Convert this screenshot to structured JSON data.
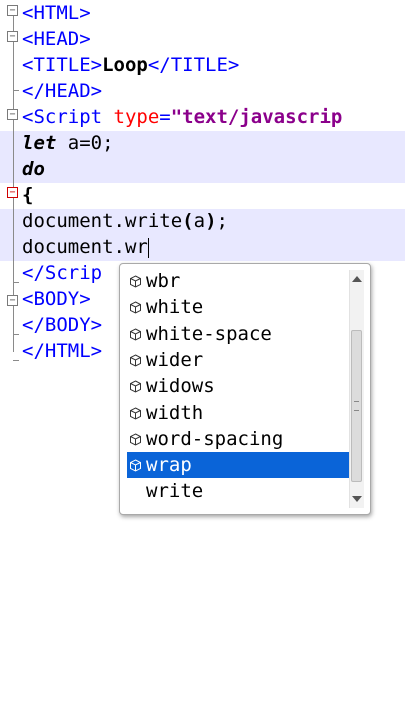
{
  "editor": {
    "lines": [
      {
        "parts": [
          {
            "cls": "tag",
            "text": "<HTML>"
          }
        ]
      },
      {
        "parts": [
          {
            "cls": "tag",
            "text": "<HEAD>"
          }
        ]
      },
      {
        "parts": [
          {
            "cls": "tag",
            "text": "<TITLE>"
          },
          {
            "cls": "bold",
            "text": "Loop"
          },
          {
            "cls": "tag",
            "text": "</TITLE>"
          }
        ]
      },
      {
        "parts": [
          {
            "cls": "tag",
            "text": "</HEAD>"
          }
        ]
      },
      {
        "parts": [
          {
            "cls": "tag",
            "text": "<Script "
          },
          {
            "cls": "attr",
            "text": "type"
          },
          {
            "cls": "tag",
            "text": "="
          },
          {
            "cls": "str",
            "text": "\"text/javascrip"
          }
        ]
      },
      {
        "parts": [
          {
            "cls": "kw",
            "text": "let"
          },
          {
            "cls": "",
            "text": " a=0;"
          }
        ]
      },
      {
        "parts": [
          {
            "cls": "kw",
            "text": "do"
          }
        ]
      },
      {
        "parts": [
          {
            "cls": "bold",
            "text": "{"
          }
        ]
      },
      {
        "parts": [
          {
            "cls": "",
            "text": "document.write"
          },
          {
            "cls": "bold",
            "text": "("
          },
          {
            "cls": "",
            "text": "a"
          },
          {
            "cls": "bold",
            "text": ")"
          },
          {
            "cls": "",
            "text": ";"
          }
        ]
      },
      {
        "parts": [
          {
            "cls": "",
            "text": "document.wr"
          }
        ]
      },
      {
        "parts": [
          {
            "cls": "tag",
            "text": "</Scrip"
          }
        ]
      },
      {
        "parts": [
          {
            "cls": "tag",
            "text": "<BODY>"
          }
        ]
      },
      {
        "parts": [
          {
            "cls": "tag",
            "text": "</BODY>"
          }
        ]
      },
      {
        "parts": [
          {
            "cls": "tag",
            "text": "</HTML>"
          }
        ]
      }
    ]
  },
  "autocomplete": {
    "items": [
      {
        "label": "wbr",
        "icon": "cube-icon"
      },
      {
        "label": "white",
        "icon": "cube-icon"
      },
      {
        "label": "white-space",
        "icon": "cube-icon"
      },
      {
        "label": "wider",
        "icon": "cube-icon"
      },
      {
        "label": "widows",
        "icon": "cube-icon"
      },
      {
        "label": "width",
        "icon": "cube-icon"
      },
      {
        "label": "word-spacing",
        "icon": "cube-icon"
      },
      {
        "label": "wrap",
        "icon": "cube-icon",
        "selected": true
      },
      {
        "label": "write",
        "icon": ""
      }
    ]
  },
  "colors": {
    "tag": "#0000ff",
    "attribute": "#ff0000",
    "string": "#8b008b",
    "current_line": "#e8e8ff",
    "selection": "#0a64d8"
  }
}
